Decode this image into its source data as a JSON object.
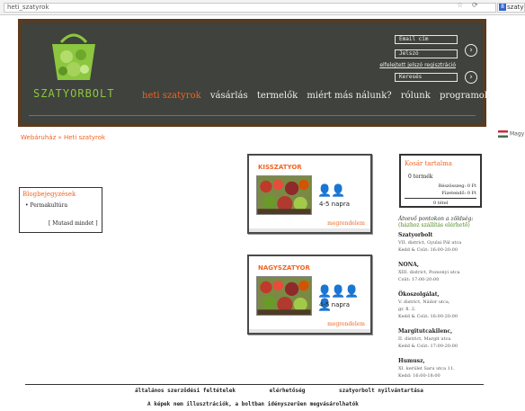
{
  "browser": {
    "url": "heti_szatyrok",
    "search_text": "szaty"
  },
  "header": {
    "logo_text": "SZATYORBOLT",
    "login": {
      "email_placeholder": "Email cím",
      "password_placeholder": "Jelszó",
      "forgot_link": "elfelejtett jelszó regisztráció",
      "search_placeholder": "Keresés"
    },
    "nav": [
      "heti szatyrok",
      "vásárlás",
      "termelők",
      "miért más nálunk?",
      "rólunk",
      "programok"
    ]
  },
  "lang_label": "Magy",
  "breadcrumb": "Webáruház » Heti szatyrok",
  "blog": {
    "title": "Blogbejegyzések",
    "items": [
      "Permakultúra"
    ],
    "more": "[ Mutasd mindet ]"
  },
  "products": [
    {
      "title": "KISSZATYOR",
      "persons": 2,
      "duration": "4-5 napra",
      "order": "megrendelem"
    },
    {
      "title": "NAGYSZATYOR",
      "persons": 4,
      "duration": "4-5 napra",
      "order": "megrendelem"
    }
  ],
  "cart": {
    "title": "Kosár tartalma",
    "items": "0 termék",
    "subtotal_label": "Részösszeg:",
    "subtotal_value": "0 Ft",
    "pay_label": "Fizetendő:",
    "pay_value": "0 Ft",
    "total": "0 tétel"
  },
  "pickup": {
    "heading": "Átvevő pontokon a zöldség:",
    "subheading": "(házhoz szállítás elérhető)",
    "points": [
      {
        "name": "Szatyorbolt",
        "lines": [
          "VII. district, Gyulai Pál utca",
          "Kedd & Csüt: 16:00-20:00"
        ]
      },
      {
        "name": "NONA,",
        "lines": [
          "XIII. district, Pozsonyi utca",
          "Csüt: 17:00-20:00"
        ]
      },
      {
        "name": "Ökoszolgálat,",
        "lines": [
          "V. district, Nádor utca,",
          "gr. fl. 2.",
          "Kedd & Csüt: 16:00-20:00"
        ]
      },
      {
        "name": "Margitutcakilenc,",
        "lines": [
          "II. district, Margit utca",
          "Kedd & Csüt: 17:00-20:00"
        ]
      },
      {
        "name": "Humusz,",
        "lines": [
          "XI. kerület Saru utca 11.",
          "Kedd: 16:00-18:00"
        ]
      }
    ]
  },
  "footer": {
    "links": [
      "általános szerződési feltételek",
      "elérhetőség",
      "szatyorbolt nyilvántartása"
    ],
    "note": "A képek nem illusztrációk, a boltban idényszerűen megvásárolhatók"
  },
  "colors": {
    "accent": "#f26522",
    "board": "#3f423d",
    "frame": "#5b3a1f",
    "logo": "#8dc63f"
  }
}
